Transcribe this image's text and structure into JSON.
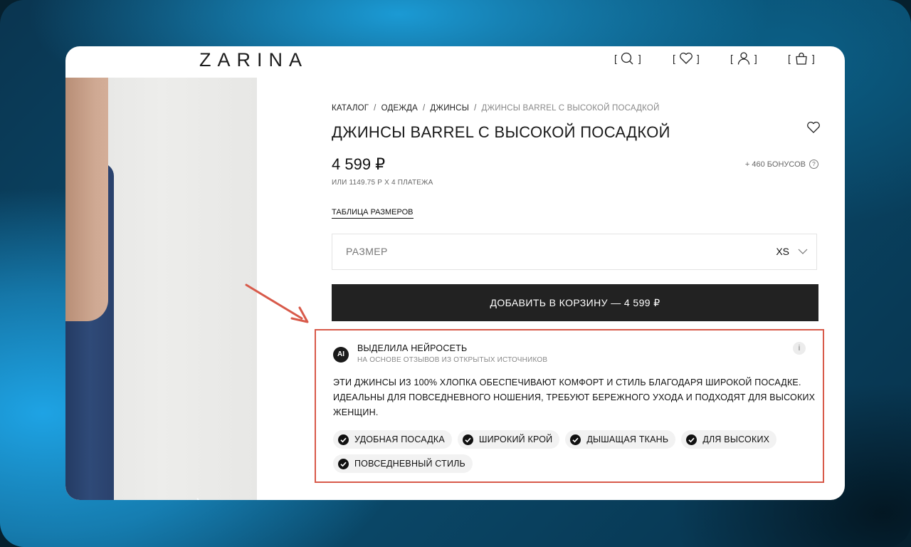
{
  "header": {
    "logo": "ZARINA",
    "icons": [
      "search-icon",
      "heart-icon",
      "user-icon",
      "bag-icon"
    ]
  },
  "breadcrumb": [
    "КАТАЛОГ",
    "ОДЕЖДА",
    "ДЖИНСЫ",
    "ДЖИНСЫ BARREL С ВЫСОКОЙ ПОСАДКОЙ"
  ],
  "product": {
    "title": "ДЖИНСЫ BARREL С ВЫСОКОЙ ПОСАДКОЙ",
    "price": "4 599 ₽",
    "bonus": "+ 460 БОНУСОВ",
    "installments": "ИЛИ 1149.75 Р X 4 ПЛАТЕЖА",
    "size_table_link": "ТАБЛИЦА РАЗМЕРОВ",
    "size_label": "РАЗМЕР",
    "size_value": "XS",
    "add_to_cart": "ДОБАВИТЬ В КОРЗИНУ — 4 599 ₽"
  },
  "ai_summary": {
    "badge": "AI",
    "title": "ВЫДЕЛИЛА НЕЙРОСЕТЬ",
    "subtitle": "НА ОСНОВЕ ОТЗЫВОВ ИЗ ОТКРЫТЫХ ИСТОЧНИКОВ",
    "info": "i",
    "text": "ЭТИ ДЖИНСЫ ИЗ 100% ХЛОПКА ОБЕСПЕЧИВАЮТ КОМФОРТ И СТИЛЬ БЛАГОДАРЯ ШИРОКОЙ ПОСАДКЕ. ИДЕАЛЬНЫ ДЛЯ ПОВСЕДНЕВНОГО НОШЕНИЯ, ТРЕБУЮТ БЕРЕЖНОГО УХОДА И ПОДХОДЯТ ДЛЯ ВЫСОКИХ ЖЕНЩИН.",
    "tags": [
      "УДОБНАЯ ПОСАДКА",
      "ШИРОКИЙ КРОЙ",
      "ДЫШАЩАЯ ТКАНЬ",
      "ДЛЯ ВЫСОКИХ",
      "ПОВСЕДНЕВНЫЙ СТИЛЬ"
    ]
  },
  "colors": {
    "highlight": "#d85a4a",
    "button": "#222222",
    "background_accent": "#1ea3e4"
  }
}
